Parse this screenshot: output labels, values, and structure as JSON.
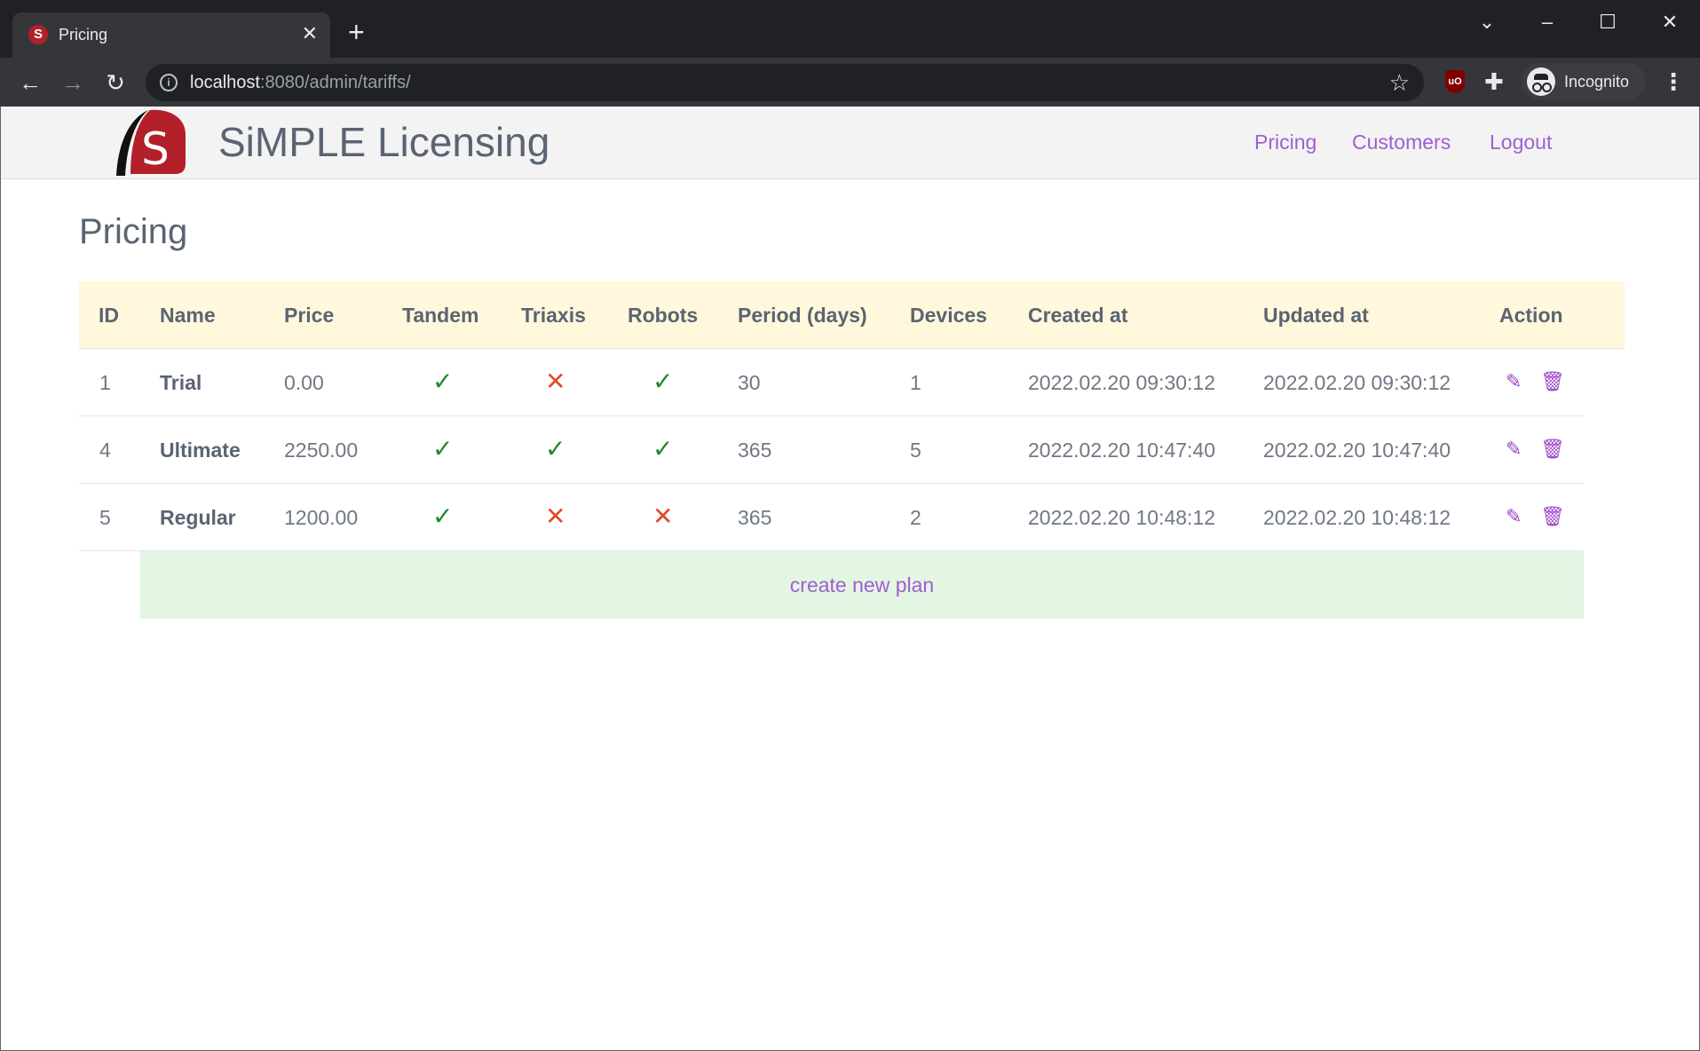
{
  "browser": {
    "tab_title": "Pricing",
    "tab_favicon_letter": "S",
    "url_host": "localhost",
    "url_rest": ":8080/admin/tariffs/",
    "profile_label": "Incognito",
    "ublock_badge": "uO",
    "icons": {
      "back": "arrow-left-icon",
      "forward": "arrow-right-icon",
      "reload": "reload-icon",
      "bookmark": "star-icon",
      "extensions": "puzzle-icon",
      "menu": "kebab-menu-icon"
    }
  },
  "header": {
    "logo_letter": "S",
    "brand": "SiMPLE Licensing",
    "nav": [
      {
        "label": "Pricing"
      },
      {
        "label": "Customers"
      },
      {
        "label": "Logout"
      }
    ]
  },
  "page": {
    "title": "Pricing"
  },
  "table": {
    "columns": [
      "ID",
      "Name",
      "Price",
      "Tandem",
      "Triaxis",
      "Robots",
      "Period (days)",
      "Devices",
      "Created at",
      "Updated at",
      "Action"
    ],
    "rows": [
      {
        "id": "1",
        "name": "Trial",
        "price": "0.00",
        "tandem": "✓",
        "triaxis": "✕",
        "robots": "✓",
        "period": "30",
        "devices": "1",
        "created": "2022.02.20 09:30:12",
        "updated": "2022.02.20 09:30:12"
      },
      {
        "id": "4",
        "name": "Ultimate",
        "price": "2250.00",
        "tandem": "✓",
        "triaxis": "✓",
        "robots": "✓",
        "period": "365",
        "devices": "5",
        "created": "2022.02.20 10:47:40",
        "updated": "2022.02.20 10:47:40"
      },
      {
        "id": "5",
        "name": "Regular",
        "price": "1200.00",
        "tandem": "✓",
        "triaxis": "✕",
        "robots": "✕",
        "period": "365",
        "devices": "2",
        "created": "2022.02.20 10:48:12",
        "updated": "2022.02.20 10:48:12"
      }
    ],
    "create_label": "create new plan"
  },
  "colors": {
    "accent": "#a05fd0",
    "header_bg": "#fff8dc",
    "create_bg": "#e3f5e3",
    "check": "#1e8a2e",
    "cross": "#e04a2a"
  }
}
